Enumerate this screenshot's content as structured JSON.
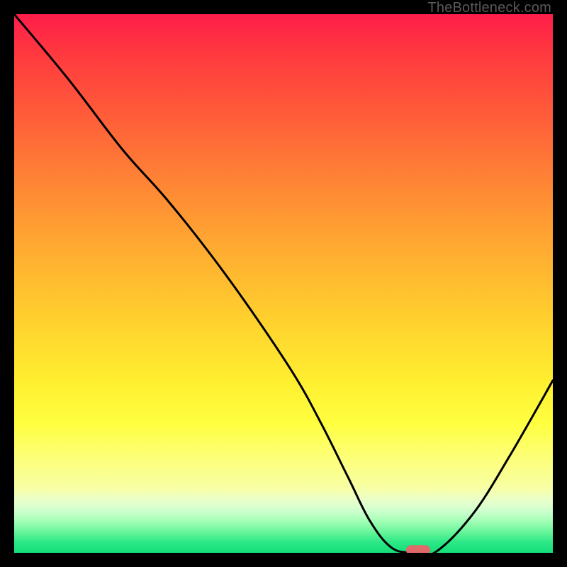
{
  "watermark": "TheBottleneck.com",
  "chart_data": {
    "type": "line",
    "title": "",
    "xlabel": "",
    "ylabel": "",
    "xlim": [
      0,
      100
    ],
    "ylim": [
      0,
      100
    ],
    "grid": false,
    "legend": false,
    "series": [
      {
        "name": "bottleneck-curve",
        "x": [
          0,
          10,
          20,
          28,
          36,
          44,
          52,
          57,
          62,
          66,
          70,
          74,
          78,
          85,
          92,
          100
        ],
        "y": [
          100,
          88,
          75,
          66,
          56,
          45,
          33,
          24,
          14,
          6,
          1,
          0,
          0,
          7,
          18,
          32
        ]
      }
    ],
    "marker": {
      "name": "optimal-point",
      "x": 75,
      "y": 0.5,
      "color": "#e06a6a",
      "shape": "rounded-pill"
    },
    "background_gradient": {
      "top": "#ff1e4a",
      "mid": "#ffee30",
      "bottom": "#14de7a"
    }
  }
}
